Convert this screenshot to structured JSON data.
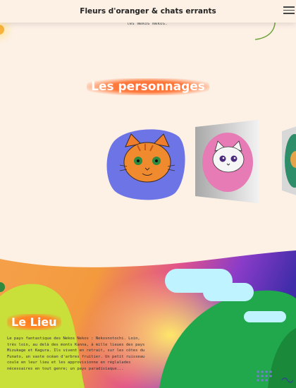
{
  "header": {
    "site_title": "Fleurs d'oranger & chats errants",
    "menu_icon": "hamburger-menu-icon"
  },
  "intro": {
    "tail_text": "les Nekos Nekos."
  },
  "characters": {
    "title": "Les personnages",
    "cards": [
      {
        "name": "orange-cat"
      },
      {
        "name": "white-cat"
      },
      {
        "name": "partial-cat"
      }
    ]
  },
  "lieu": {
    "title": "Le Lieu",
    "text": "Le pays fantastique des Nekos Nekos : Nekosnotochi. Loin, très loin, au delà des monts Kanna, à mille lieues des pays Mizukage et Kagura. Ils vivent en retrait, sur les côtes du Funato, un vaste océan d'arbres fruitier. Un petit ruisseau coule en leur lieu et les approvisionne en réglalades nécessaires en tout genre; un pays paradisiaque..."
  },
  "colors": {
    "background": "#fdf1e6",
    "accent": "#ff6b35"
  }
}
